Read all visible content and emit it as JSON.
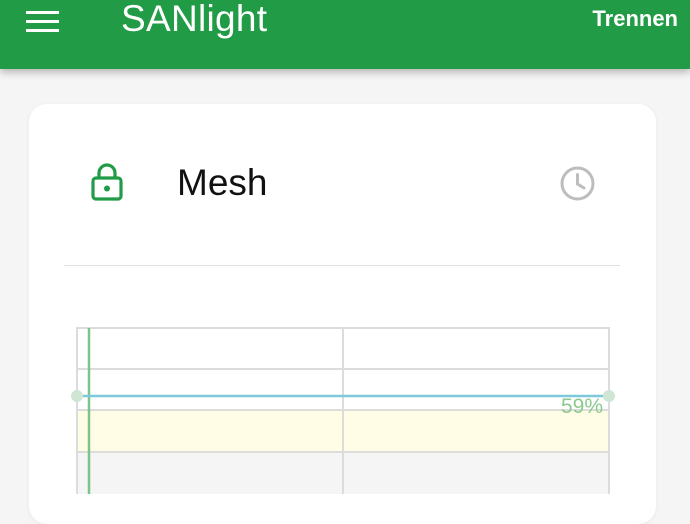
{
  "app": {
    "title": "SANlight",
    "disconnect_label": "Trennen"
  },
  "icons": {
    "menu": "hamburger-menu-icon",
    "lock": "lock-icon",
    "clock": "clock-icon"
  },
  "colors": {
    "appbar": "#219b45",
    "lock": "#219b45",
    "clock": "#bdbdbd",
    "level_line": "#7ec8dc",
    "time_marker": "#7cc487",
    "level_band": "#fffde6",
    "level_label": "#8cc98c"
  },
  "group": {
    "name": "Mesh",
    "level_label": "59%"
  },
  "chart_data": {
    "type": "line",
    "y_unit": "%",
    "series": [
      {
        "values": [
          59,
          59
        ]
      }
    ]
  }
}
